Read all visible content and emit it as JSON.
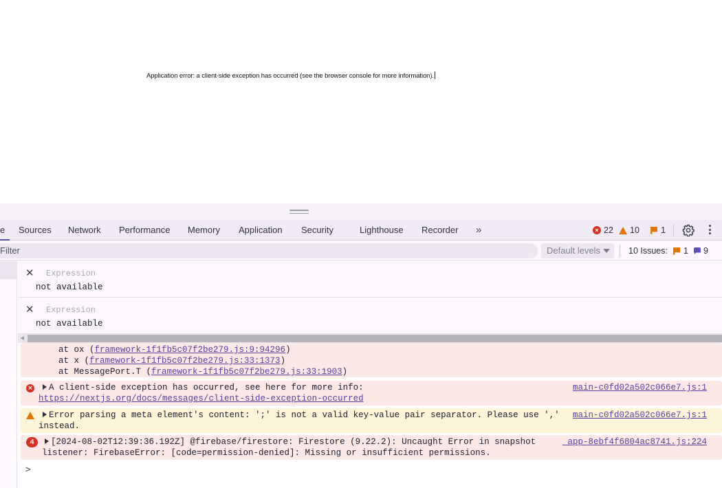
{
  "page": {
    "error_message": "Application error: a client-side exception has occurred (see the browser console for more information)."
  },
  "devtools": {
    "tabs": [
      "Sources",
      "Network",
      "Performance",
      "Memory",
      "Application",
      "Security",
      "Lighthouse",
      "Recorder"
    ],
    "active_tab_fragment": "e",
    "more_tabs_glyph": "»",
    "counts": {
      "errors": "22",
      "warnings": "10",
      "issues": "1"
    },
    "filter": {
      "placeholder": "Filter"
    },
    "levels": {
      "label": "Default levels"
    },
    "issues_summary": {
      "label": "10 Issues:",
      "flag_count": "1",
      "message_count": "9"
    }
  },
  "live_expressions": [
    {
      "placeholder": "Expression",
      "value": "not available"
    },
    {
      "placeholder": "Expression",
      "value": "not available"
    }
  ],
  "stack": {
    "frames": [
      {
        "prefix": "at ox (",
        "link": "framework-1f1fb5c07f2be279.js:9:94296",
        "suffix": ")"
      },
      {
        "prefix": "at x (",
        "link": "framework-1f1fb5c07f2be279.js:33:1373",
        "suffix": ")"
      },
      {
        "prefix": "at MessagePort.T (",
        "link": "framework-1f1fb5c07f2be279.js:33:1903",
        "suffix": ")"
      }
    ]
  },
  "messages": [
    {
      "level": "error",
      "text": "A client-side exception has occurred, see here for more info:",
      "link": "https://nextjs.org/docs/messages/client-side-exception-occurred",
      "source": "main-c0fd02a502c066e7.js:1"
    },
    {
      "level": "warning",
      "text": "Error parsing a meta element's content: ';' is not a valid key-value pair separator. Please use ','",
      "text2": "instead.",
      "source": "main-c0fd02a502c066e7.js:1"
    },
    {
      "level": "error",
      "count": "4",
      "text": "[2024-08-02T12:39:36.192Z]  @firebase/firestore: Firestore (9.22.2): Uncaught Error in snapshot",
      "text2": "listener: FirebaseError: [code=permission-denied]: Missing or insufficient permissions.",
      "source": "_app-8ebf4f6804ac8741.js:224"
    }
  ],
  "prompt_glyph": ">",
  "colors": {
    "accent": "#5b4fb5",
    "error": "#d93025",
    "warning": "#e37400",
    "error_bg": "#fbe8e7",
    "warning_bg": "#fdf5d8"
  }
}
